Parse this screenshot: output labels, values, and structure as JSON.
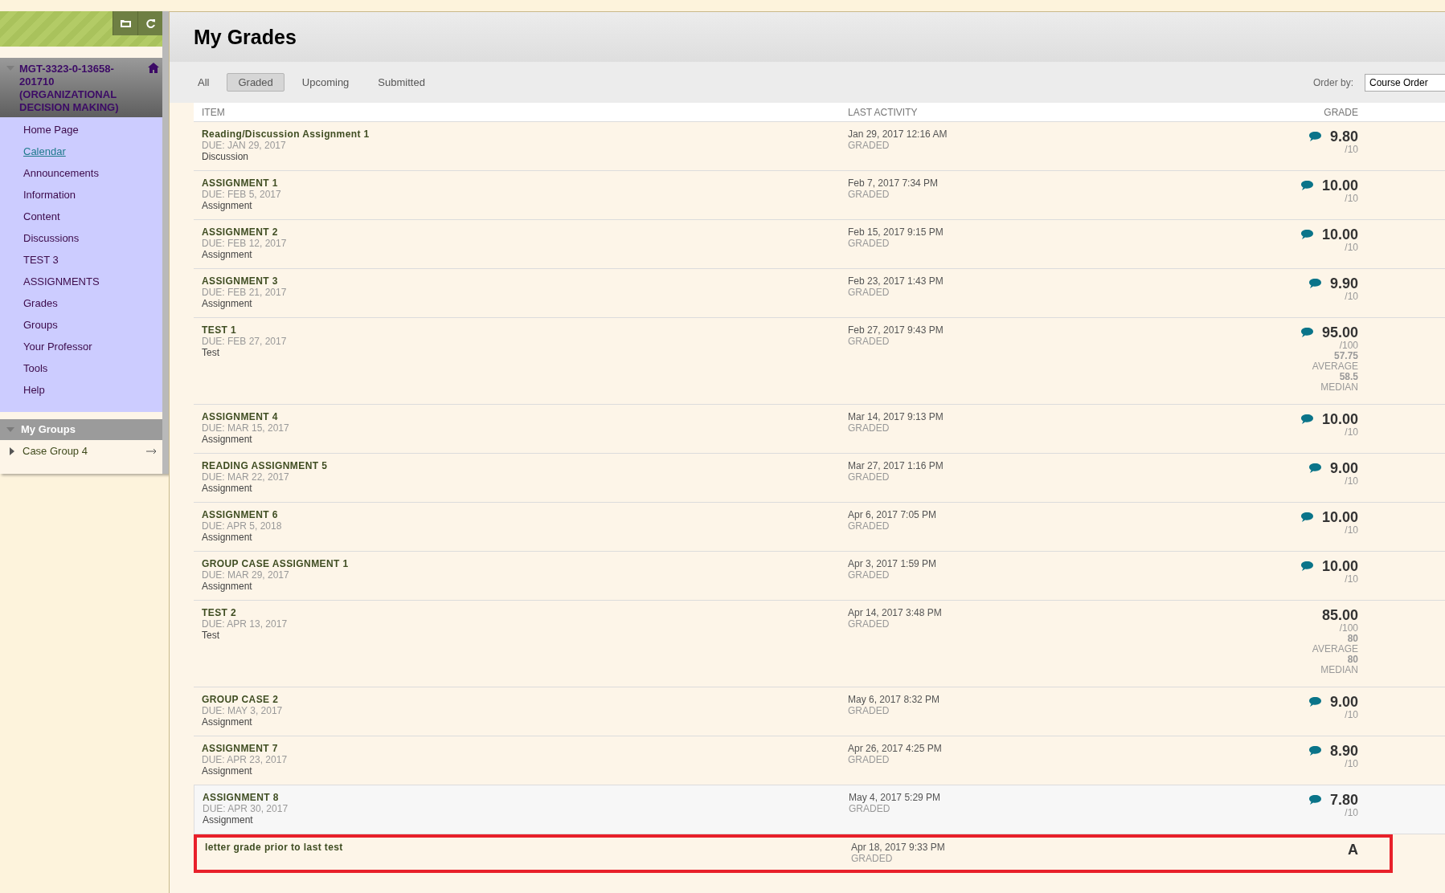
{
  "sidebar": {
    "course": {
      "title": "MGT-3323-0-13658-201710 (ORGANIZATIONAL DECISION MAKING)",
      "expanded": true
    },
    "menu": [
      {
        "label": "Home Page",
        "hovered": false
      },
      {
        "label": "Calendar",
        "hovered": true
      },
      {
        "label": "Announcements",
        "hovered": false
      },
      {
        "label": "Information",
        "hovered": false
      },
      {
        "label": "Content",
        "hovered": false
      },
      {
        "label": "Discussions",
        "hovered": false
      },
      {
        "label": "TEST 3",
        "hovered": false
      },
      {
        "label": "ASSIGNMENTS",
        "hovered": false
      },
      {
        "label": "Grades",
        "hovered": false
      },
      {
        "label": "Groups",
        "hovered": false
      },
      {
        "label": "Your Professor",
        "hovered": false
      },
      {
        "label": "Tools",
        "hovered": false
      },
      {
        "label": "Help",
        "hovered": false
      }
    ],
    "groups": {
      "title": "My Groups",
      "expanded": true,
      "items": [
        {
          "label": "Case Group 4",
          "expanded": false
        }
      ]
    }
  },
  "page": {
    "title": "My Grades"
  },
  "filters": [
    {
      "label": "All",
      "selected": false
    },
    {
      "label": "Graded",
      "selected": true
    },
    {
      "label": "Upcoming",
      "selected": false
    },
    {
      "label": "Submitted",
      "selected": false
    }
  ],
  "order_by": {
    "label": "Order by:",
    "value": "Course Order"
  },
  "table": {
    "columns": [
      "ITEM",
      "LAST ACTIVITY",
      "GRADE"
    ],
    "rows": [
      {
        "title": "Reading/Discussion Assignment 1",
        "due": "DUE: JAN 29, 2017",
        "category": "Discussion",
        "activity": "Jan 29, 2017 12:16 AM",
        "status": "GRADED",
        "grade": "9.80",
        "out_of": "/10",
        "has_comment": true,
        "stats": [],
        "hovered": false,
        "highlighted": false
      },
      {
        "title": "ASSIGNMENT 1",
        "due": "DUE: FEB 5, 2017",
        "category": "Assignment",
        "activity": "Feb 7, 2017 7:34 PM",
        "status": "GRADED",
        "grade": "10.00",
        "out_of": "/10",
        "has_comment": true,
        "stats": [],
        "hovered": false,
        "highlighted": false
      },
      {
        "title": "ASSIGNMENT 2",
        "due": "DUE: FEB 12, 2017",
        "category": "Assignment",
        "activity": "Feb 15, 2017 9:15 PM",
        "status": "GRADED",
        "grade": "10.00",
        "out_of": "/10",
        "has_comment": true,
        "stats": [],
        "hovered": false,
        "highlighted": false
      },
      {
        "title": "ASSIGNMENT 3",
        "due": "DUE: FEB 21, 2017",
        "category": "Assignment",
        "activity": "Feb 23, 2017 1:43 PM",
        "status": "GRADED",
        "grade": "9.90",
        "out_of": "/10",
        "has_comment": true,
        "stats": [],
        "hovered": false,
        "highlighted": false
      },
      {
        "title": "TEST 1",
        "due": "DUE: FEB 27, 2017",
        "category": "Test",
        "activity": "Feb 27, 2017 9:43 PM",
        "status": "GRADED",
        "grade": "95.00",
        "out_of": "/100",
        "has_comment": true,
        "stats": [
          {
            "value": "57.75",
            "label": "AVERAGE"
          },
          {
            "value": "58.5",
            "label": "MEDIAN"
          }
        ],
        "hovered": false,
        "highlighted": false
      },
      {
        "title": "ASSIGNMENT 4",
        "due": "DUE: MAR 15, 2017",
        "category": "Assignment",
        "activity": "Mar 14, 2017 9:13 PM",
        "status": "GRADED",
        "grade": "10.00",
        "out_of": "/10",
        "has_comment": true,
        "stats": [],
        "hovered": false,
        "highlighted": false
      },
      {
        "title": "READING ASSIGNMENT 5",
        "due": "DUE: MAR 22, 2017",
        "category": "Assignment",
        "activity": "Mar 27, 2017 1:16 PM",
        "status": "GRADED",
        "grade": "9.00",
        "out_of": "/10",
        "has_comment": true,
        "stats": [],
        "hovered": false,
        "highlighted": false
      },
      {
        "title": "ASSIGNMENT 6",
        "due": "DUE: APR 5, 2018",
        "category": "Assignment",
        "activity": "Apr 6, 2017 7:05 PM",
        "status": "GRADED",
        "grade": "10.00",
        "out_of": "/10",
        "has_comment": true,
        "stats": [],
        "hovered": false,
        "highlighted": false
      },
      {
        "title": "GROUP CASE ASSIGNMENT 1",
        "due": "DUE: MAR 29, 2017",
        "category": "Assignment",
        "activity": "Apr 3, 2017 1:59 PM",
        "status": "GRADED",
        "grade": "10.00",
        "out_of": "/10",
        "has_comment": true,
        "stats": [],
        "hovered": false,
        "highlighted": false
      },
      {
        "title": "TEST 2",
        "due": "DUE: APR 13, 2017",
        "category": "Test",
        "activity": "Apr 14, 2017 3:48 PM",
        "status": "GRADED",
        "grade": "85.00",
        "out_of": "/100",
        "has_comment": false,
        "stats": [
          {
            "value": "80",
            "label": "AVERAGE"
          },
          {
            "value": "80",
            "label": "MEDIAN"
          }
        ],
        "hovered": false,
        "highlighted": false
      },
      {
        "title": "GROUP CASE 2",
        "due": "DUE: MAY 3, 2017",
        "category": "Assignment",
        "activity": "May 6, 2017 8:32 PM",
        "status": "GRADED",
        "grade": "9.00",
        "out_of": "/10",
        "has_comment": true,
        "stats": [],
        "hovered": false,
        "highlighted": false
      },
      {
        "title": "ASSIGNMENT 7",
        "due": "DUE: APR 23, 2017",
        "category": "Assignment",
        "activity": "Apr 26, 2017 4:25 PM",
        "status": "GRADED",
        "grade": "8.90",
        "out_of": "/10",
        "has_comment": true,
        "stats": [],
        "hovered": false,
        "highlighted": false
      },
      {
        "title": "ASSIGNMENT 8",
        "due": "DUE: APR 30, 2017",
        "category": "Assignment",
        "activity": "May 4, 2017 5:29 PM",
        "status": "GRADED",
        "grade": "7.80",
        "out_of": "/10",
        "has_comment": true,
        "stats": [],
        "hovered": true,
        "highlighted": false
      },
      {
        "title": "letter grade prior to last test",
        "activity": "Apr 18, 2017 9:33 PM",
        "status": "GRADED",
        "grade": "A",
        "has_comment": false,
        "stats": [],
        "hovered": false,
        "highlighted": true
      }
    ]
  }
}
